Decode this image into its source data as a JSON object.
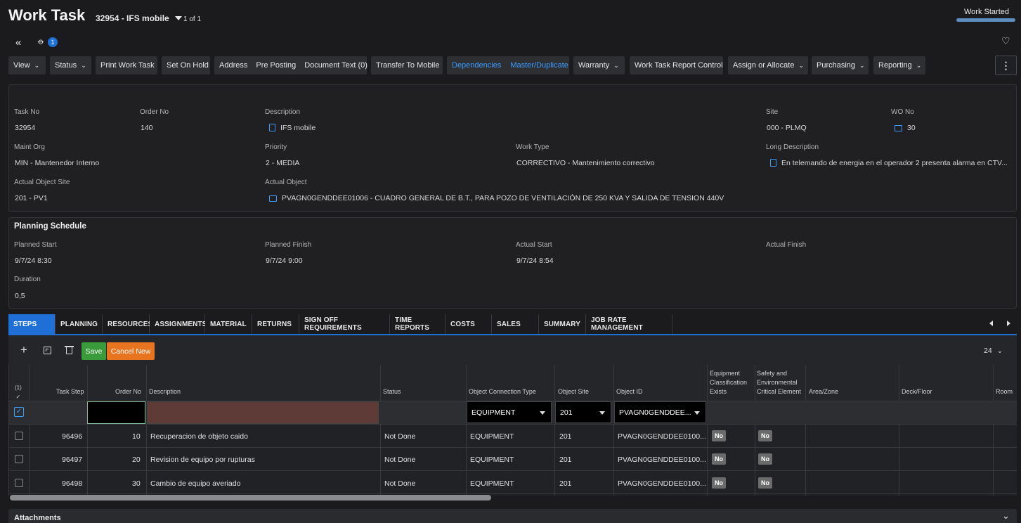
{
  "header": {
    "title": "Work Task",
    "record": "32954 - IFS mobile",
    "pager": "1 of 1",
    "status": "Work Started",
    "status_progress": 1.0,
    "attachments_count": "1"
  },
  "toolbar": {
    "view": "View",
    "status": "Status",
    "print": "Print Work Task",
    "hold": "Set On Hold",
    "address": "Address",
    "preposting": "Pre Posting",
    "doctext": "Document Text (0)",
    "transfer": "Transfer To Mobile",
    "dependencies": "Dependencies",
    "master": "Master/Duplicate",
    "warranty": "Warranty",
    "report_control": "Work Task Report Control",
    "assign": "Assign or Allocate",
    "purchasing": "Purchasing",
    "reporting": "Reporting"
  },
  "details": {
    "task_no_label": "Task No",
    "task_no": "32954",
    "order_no_label": "Order No",
    "order_no": "140",
    "description_label": "Description",
    "description": "IFS mobile",
    "site_label": "Site",
    "site": "000 - PLMQ",
    "wo_no_label": "WO No",
    "wo_no": "30",
    "maint_org_label": "Maint Org",
    "maint_org": "MIN - Mantenedor Interno",
    "priority_label": "Priority",
    "priority": "2 - MEDIA",
    "work_type_label": "Work Type",
    "work_type": "CORRECTIVO - Mantenimiento correctivo",
    "long_desc_label": "Long Description",
    "long_desc": "En telemando de energia en el operador 2 presenta alarma en CTV...",
    "obj_site_label": "Actual Object Site",
    "obj_site": "201 - PV1",
    "obj_label": "Actual Object",
    "obj": "PVAGN0GENDDEE01006 - CUADRO GENERAL DE B.T., PARA POZO DE VENTILACIÓN DE 250 KVA Y SALIDA DE TENSION 440V"
  },
  "schedule": {
    "title": "Planning Schedule",
    "planned_start_label": "Planned Start",
    "planned_start": "9/7/24 8:30",
    "planned_finish_label": "Planned Finish",
    "planned_finish": "9/7/24 9:00",
    "actual_start_label": "Actual Start",
    "actual_start": "9/7/24 8:54",
    "actual_finish_label": "Actual Finish",
    "duration_label": "Duration",
    "duration": "0,5"
  },
  "tabs": [
    "STEPS",
    "PLANNING",
    "RESOURCES",
    "ASSIGNMENTS",
    "MATERIAL",
    "RETURNS",
    "SIGN OFF REQUIREMENTS",
    "TIME REPORTS",
    "COSTS",
    "SALES",
    "SUMMARY",
    "JOB RATE MANAGEMENT"
  ],
  "grid_toolbar": {
    "save": "Save",
    "cancel": "Cancel New",
    "page_size": "24"
  },
  "columns": {
    "selected": "(1)",
    "task_step": "Task Step",
    "order_no": "Order No",
    "description": "Description",
    "status": "Status",
    "conn_type": "Object Connection Type",
    "object_site": "Object Site",
    "object_id": "Object ID",
    "equip_class_1": "Equipment",
    "equip_class_2": "Classification",
    "equip_class_3": "Exists",
    "safety_1": "Safety and",
    "safety_2": "Environmental",
    "safety_3": "Critical Element",
    "area": "Area/Zone",
    "deck": "Deck/Floor",
    "room": "Room"
  },
  "new_row": {
    "conn_type": "EQUIPMENT",
    "site": "201",
    "object_id": "PVAGN0GENDDEE..."
  },
  "rows": [
    {
      "task_step": "96496",
      "order_no": "10",
      "description": "Recuperacion de objeto caido",
      "status": "Not Done",
      "conn_type": "EQUIPMENT",
      "site": "201",
      "object_id": "PVAGN0GENDDEE0100...",
      "equip": "No",
      "safety": "No"
    },
    {
      "task_step": "96497",
      "order_no": "20",
      "description": "Revision de equipo por rupturas",
      "status": "Not Done",
      "conn_type": "EQUIPMENT",
      "site": "201",
      "object_id": "PVAGN0GENDDEE0100...",
      "equip": "No",
      "safety": "No"
    },
    {
      "task_step": "96498",
      "order_no": "30",
      "description": "Cambio de equipo averiado",
      "status": "Not Done",
      "conn_type": "EQUIPMENT",
      "site": "201",
      "object_id": "PVAGN0GENDDEE0100...",
      "equip": "No",
      "safety": "No"
    }
  ],
  "attachments": {
    "title": "Attachments"
  }
}
